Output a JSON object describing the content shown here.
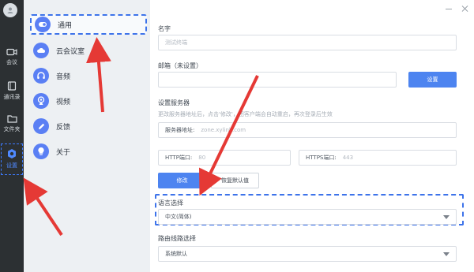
{
  "rail": {
    "items": [
      {
        "label": "会议"
      },
      {
        "label": "通讯录"
      },
      {
        "label": "文件夹"
      },
      {
        "label": "设置"
      }
    ]
  },
  "nav": {
    "items": [
      {
        "label": "通用"
      },
      {
        "label": "云会议室"
      },
      {
        "label": "音频"
      },
      {
        "label": "视频"
      },
      {
        "label": "反馈"
      },
      {
        "label": "关于"
      }
    ]
  },
  "form": {
    "name_label": "名字",
    "name_placeholder": "测试终端",
    "email_label": "邮箱（未设置）",
    "email_button": "设置",
    "server_label": "设置服务器",
    "server_hint": "更改服务器地址后，点击'修改'，团客户端会自动重启，再次登录后生效",
    "server_address_label": "服务器地址:",
    "server_address_value": "zone.xylink.com",
    "http_label": "HTTP端口:",
    "http_value": "80",
    "https_label": "HTTPS端口:",
    "https_value": "443",
    "modify_button": "修改",
    "restore_button": "恢复默认值",
    "language_label": "语言选择",
    "language_value": "中文(简体)",
    "route_label": "路由线路选择",
    "route_value": "系统默认"
  },
  "colors": {
    "accent": "#3d73ea",
    "primary_button": "#4d84f0",
    "annotation": "#e53935"
  }
}
